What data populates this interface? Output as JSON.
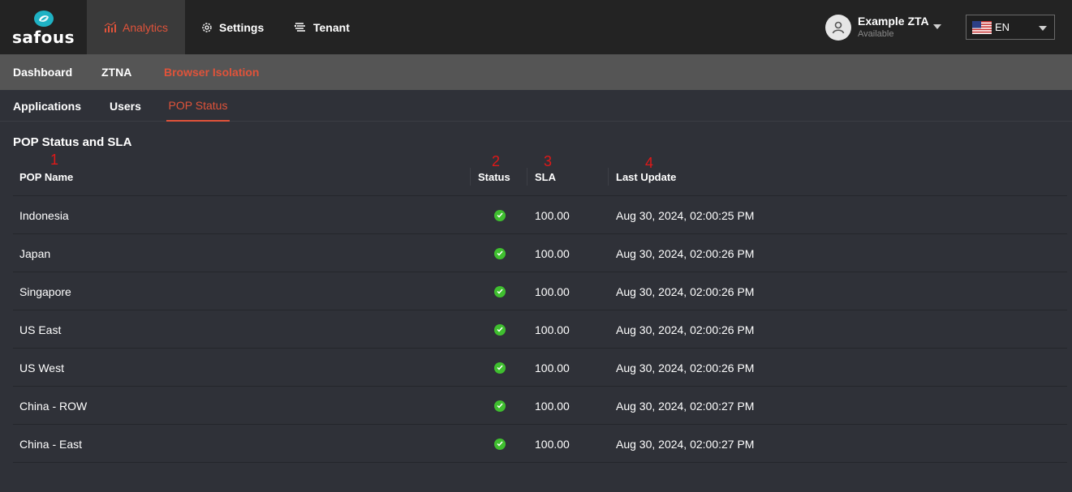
{
  "brand": {
    "name": "safous"
  },
  "nav": {
    "analytics": "Analytics",
    "settings": "Settings",
    "tenant": "Tenant"
  },
  "user": {
    "name": "Example ZTA",
    "status": "Available"
  },
  "language": {
    "label": "EN",
    "flag": "us-flag-icon"
  },
  "subnav": {
    "dashboard": "Dashboard",
    "ztna": "ZTNA",
    "browser_isolation": "Browser Isolation"
  },
  "tabs": {
    "applications": "Applications",
    "users": "Users",
    "pop_status": "POP Status"
  },
  "section_title": "POP Status and SLA",
  "markers": [
    "1",
    "2",
    "3",
    "4"
  ],
  "table": {
    "columns": [
      "POP Name",
      "Status",
      "SLA",
      "Last Update"
    ],
    "rows": [
      {
        "name": "Indonesia",
        "status": "ok",
        "sla": "100.00",
        "last_update": "Aug 30, 2024, 02:00:25 PM"
      },
      {
        "name": "Japan",
        "status": "ok",
        "sla": "100.00",
        "last_update": "Aug 30, 2024, 02:00:26 PM"
      },
      {
        "name": "Singapore",
        "status": "ok",
        "sla": "100.00",
        "last_update": "Aug 30, 2024, 02:00:26 PM"
      },
      {
        "name": "US East",
        "status": "ok",
        "sla": "100.00",
        "last_update": "Aug 30, 2024, 02:00:26 PM"
      },
      {
        "name": "US West",
        "status": "ok",
        "sla": "100.00",
        "last_update": "Aug 30, 2024, 02:00:26 PM"
      },
      {
        "name": "China - ROW",
        "status": "ok",
        "sla": "100.00",
        "last_update": "Aug 30, 2024, 02:00:27 PM"
      },
      {
        "name": "China - East",
        "status": "ok",
        "sla": "100.00",
        "last_update": "Aug 30, 2024, 02:00:27 PM"
      }
    ]
  },
  "colors": {
    "accent": "#e0533a",
    "status_ok": "#3fbf2f",
    "marker": "#e01818"
  }
}
